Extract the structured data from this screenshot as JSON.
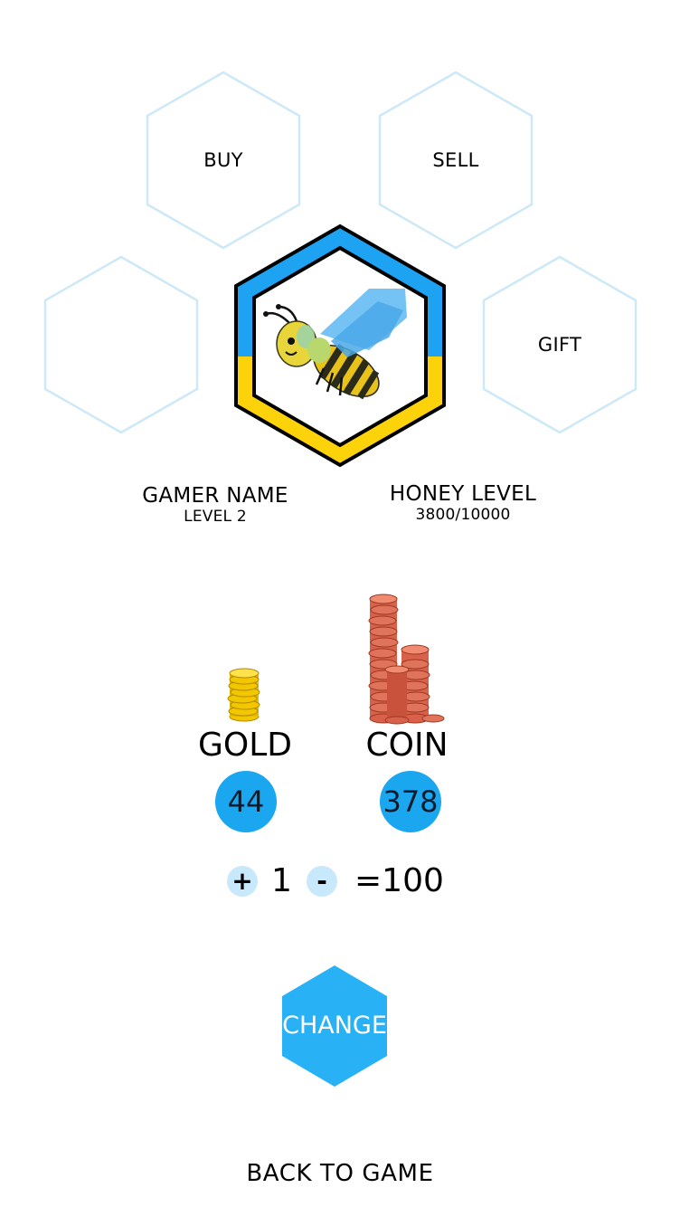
{
  "menu": {
    "buy_label": "BUY",
    "sell_label": "SELL",
    "empty_label": "",
    "gift_label": "GIFT"
  },
  "profile": {
    "gamer_name": "GAMER NAME",
    "level": "LEVEL 2",
    "honey_title": "HONEY LEVEL",
    "honey_value": "3800/10000",
    "avatar_icon": "bee-icon"
  },
  "currencies": {
    "gold": {
      "label": "GOLD",
      "count": "44",
      "icon": "gold-coins-icon"
    },
    "coin": {
      "label": "COIN",
      "count": "378",
      "icon": "copper-coins-icon"
    }
  },
  "exchange": {
    "plus_label": "+",
    "quantity": "1",
    "minus_label": "-",
    "result": "=100"
  },
  "actions": {
    "change_label": "CHANGE",
    "back_label": "BACK TO GAME"
  },
  "colors": {
    "accent_blue": "#1aa7f0",
    "avatar_blue": "#1da3f2",
    "avatar_yellow": "#fcd20a",
    "hex_outline": "#cde9f7",
    "button_light": "#c8e9fb"
  }
}
